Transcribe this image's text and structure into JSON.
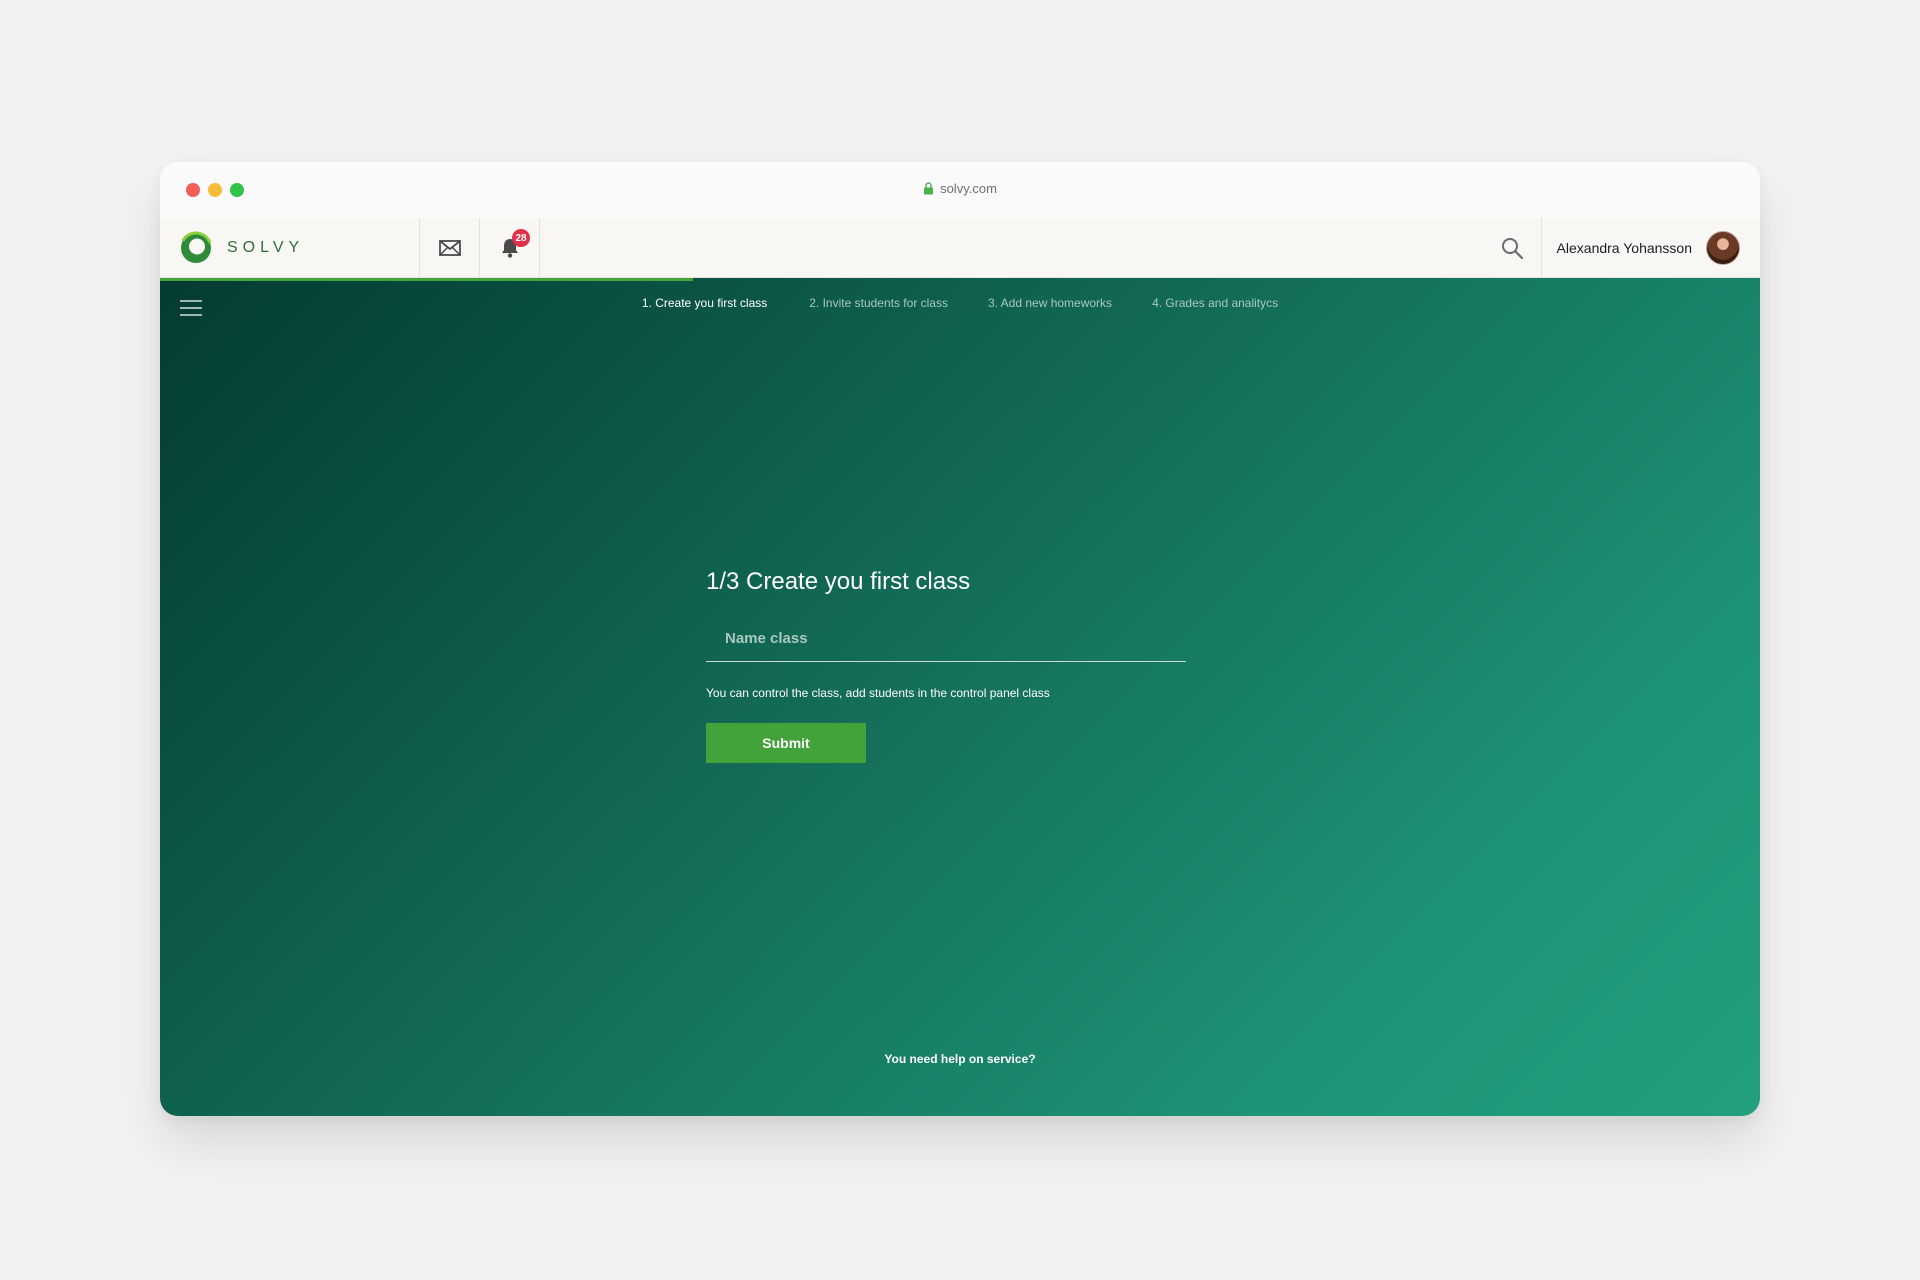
{
  "browser": {
    "url": "solvy.com"
  },
  "appbar": {
    "logo_text": "SOLVY",
    "notification_count": "28",
    "user_name": "Alexandra Yohansson",
    "icons": [
      "mail-icon",
      "bell-icon",
      "search-icon"
    ]
  },
  "progress": {
    "fraction": 0.333
  },
  "steps": [
    {
      "label": "1. Create you first class",
      "active": true
    },
    {
      "label": "2. Invite students for class",
      "active": false
    },
    {
      "label": "3. Add new homeworks",
      "active": false
    },
    {
      "label": "4. Grades and analitycs",
      "active": false
    }
  ],
  "form": {
    "title": "1/3 Create you first class",
    "name_placeholder": "Name class",
    "name_value": "",
    "helper_text": "You can control the class, add students in the control panel class",
    "submit_label": "Submit"
  },
  "footer": {
    "help_text": "You need help on service?"
  },
  "colors": {
    "accent": "#41a33a",
    "badge": "#e3304a",
    "brand": "#2e6f3a"
  }
}
